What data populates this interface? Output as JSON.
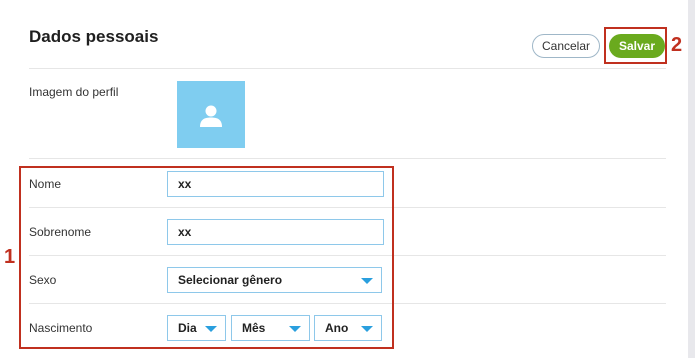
{
  "header": {
    "title": "Dados pessoais",
    "cancel_label": "Cancelar",
    "save_label": "Salvar"
  },
  "profile": {
    "image_label": "Imagem do perfil"
  },
  "form": {
    "first_name": {
      "label": "Nome",
      "value": "xx"
    },
    "last_name": {
      "label": "Sobrenome",
      "value": "xx"
    },
    "gender": {
      "label": "Sexo",
      "selected": "Selecionar gênero"
    },
    "birth": {
      "label": "Nascimento",
      "day": "Dia",
      "month": "Mês",
      "year": "Ano"
    }
  },
  "annotations": {
    "callout_1": "1",
    "callout_2": "2",
    "color": "#c0301f"
  },
  "colors": {
    "save_button": "#6aaa1e",
    "accent_blue": "#2a9fde",
    "avatar_bg": "#7fcdf0"
  },
  "icons": {
    "avatar": "person-icon",
    "dropdown": "chevron-down-icon"
  }
}
